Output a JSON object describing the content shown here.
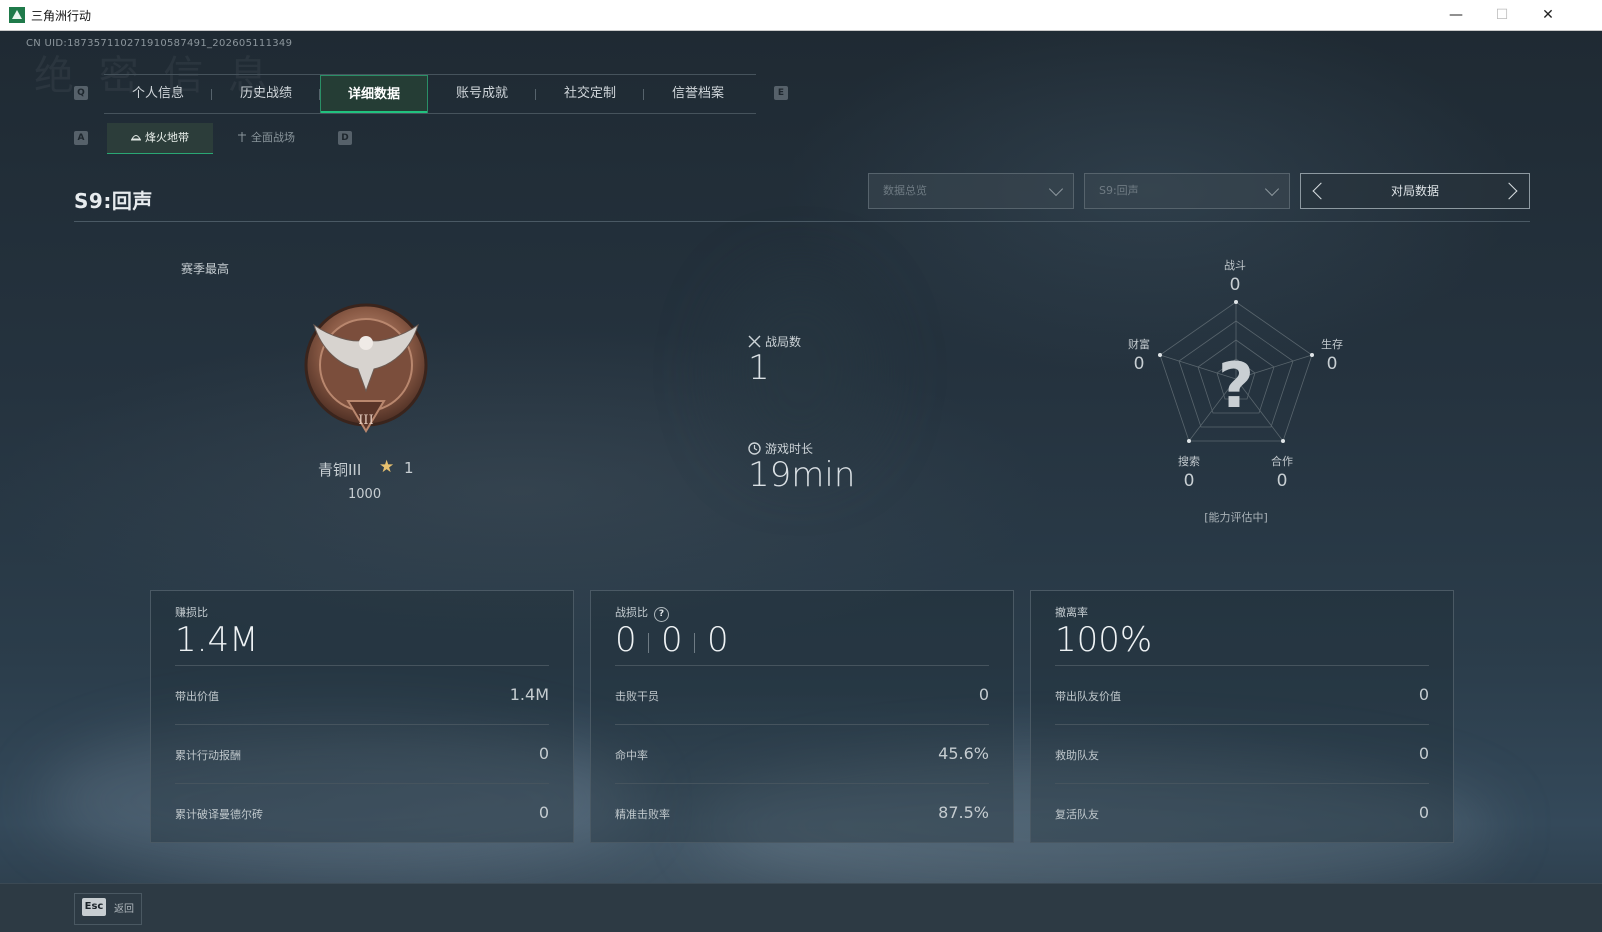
{
  "window": {
    "title": "三角洲行动",
    "minimize": "—",
    "maximize": "☐",
    "close": "✕"
  },
  "uid": "CN UID:1873571102719105874​91_202605111349",
  "tabs": {
    "prev_key": "Q",
    "next_key": "E",
    "items": [
      {
        "label": "个人信息"
      },
      {
        "label": "历史战绩"
      },
      {
        "label": "详细数据"
      },
      {
        "label": "账号成就"
      },
      {
        "label": "社交定制"
      },
      {
        "label": "信誉档案"
      }
    ],
    "active_index": 2
  },
  "subtabs": {
    "prev_key": "A",
    "next_key": "D",
    "items": [
      {
        "label": "烽火地带"
      },
      {
        "label": "全面战场"
      }
    ],
    "active_index": 0
  },
  "season": {
    "title": "S9:回声",
    "filter_view": "数据总览",
    "filter_season": "S9:回声",
    "pager_label": "对局数据"
  },
  "rank": {
    "caption": "赛季最高",
    "name": "青铜III",
    "stars": "1",
    "score": "1000",
    "badge_numeral": "III"
  },
  "stats": {
    "matches_label": "战局数",
    "matches_value": "1",
    "duration_label": "游戏时长",
    "duration_value": "19min"
  },
  "radar": {
    "center_mark": "?",
    "note": "[能力评估中]",
    "axes": [
      {
        "label": "战斗",
        "value": "0"
      },
      {
        "label": "生存",
        "value": "0"
      },
      {
        "label": "合作",
        "value": "0"
      },
      {
        "label": "搜索",
        "value": "0"
      },
      {
        "label": "财富",
        "value": "0"
      }
    ]
  },
  "panels": {
    "profit": {
      "caption": "赚损比",
      "big": "1.4M",
      "rows": [
        {
          "k": "带出价值",
          "v": "1.4M"
        },
        {
          "k": "累计行动报酬",
          "v": "0"
        },
        {
          "k": "累计破译曼德尔砖",
          "v": "0"
        }
      ]
    },
    "kd": {
      "caption": "战损比",
      "help": "?",
      "values": [
        "0",
        "0",
        "0"
      ],
      "rows": [
        {
          "k": "击败干员",
          "v": "0"
        },
        {
          "k": "命中率",
          "v": "45.6%"
        },
        {
          "k": "精准击败率",
          "v": "87.5%"
        }
      ]
    },
    "extract": {
      "caption": "撤离率",
      "big": "100%",
      "rows": [
        {
          "k": "带出队友价值",
          "v": "0"
        },
        {
          "k": "救助队友",
          "v": "0"
        },
        {
          "k": "复活队友",
          "v": "0"
        }
      ]
    }
  },
  "footer": {
    "esc_key": "Esc",
    "back_label": "返回"
  },
  "colors": {
    "accent": "#21c27f",
    "background": "#1f2a33",
    "badge_bronze": "#8a5a45"
  }
}
